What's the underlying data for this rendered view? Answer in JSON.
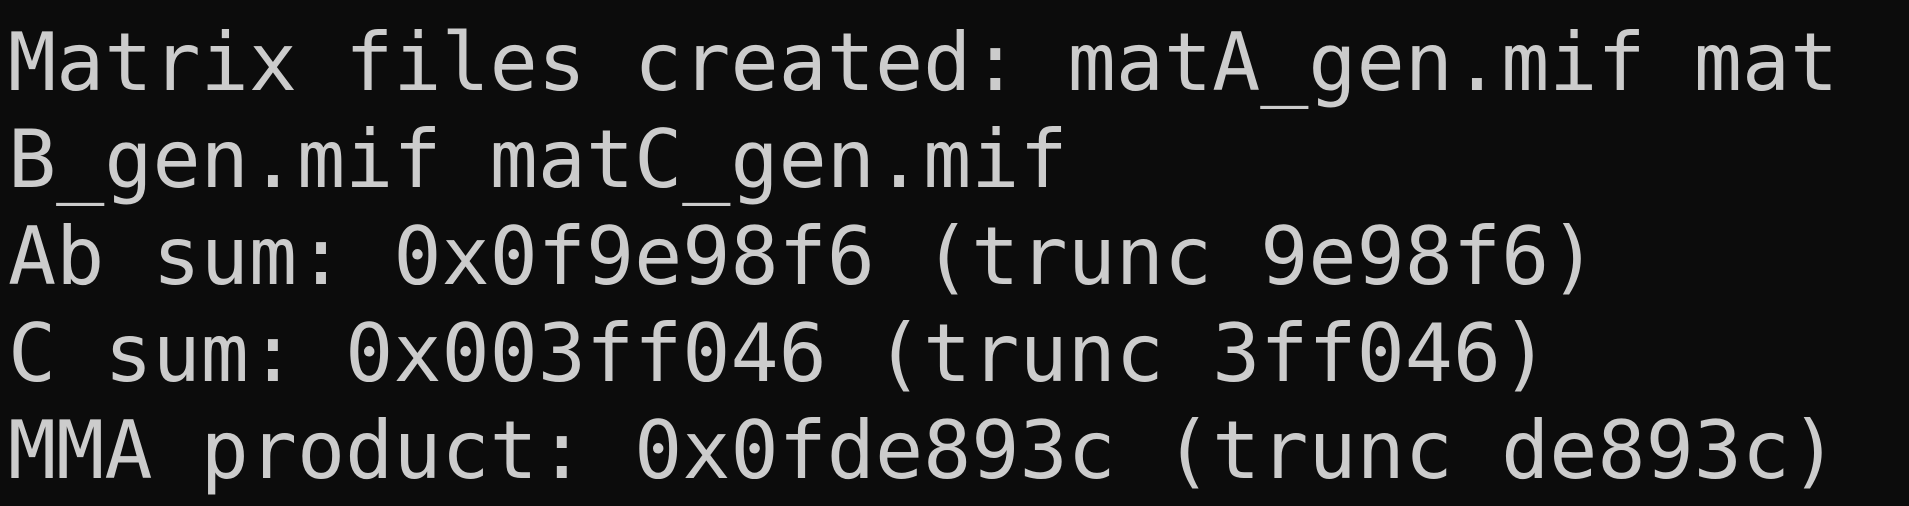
{
  "colors": {
    "background": "#0c0c0c",
    "foreground": "#cccccc"
  },
  "terminal": {
    "lines": [
      "Matrix files created: matA_gen.mif mat",
      "B_gen.mif matC_gen.mif",
      "Ab sum: 0x0f9e98f6 (trunc 9e98f6)",
      "C sum: 0x003ff046 (trunc 3ff046)",
      "MMA product: 0x0fde893c (trunc de893c)"
    ]
  }
}
